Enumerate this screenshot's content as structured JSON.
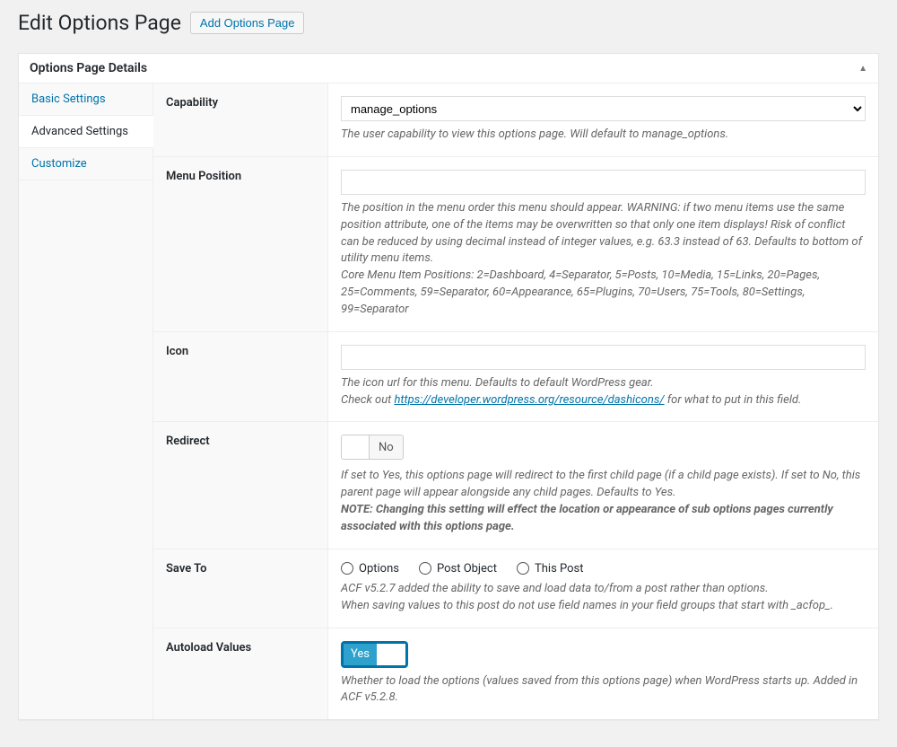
{
  "header": {
    "title": "Edit Options Page",
    "add_button": "Add Options Page"
  },
  "panel": {
    "title": "Options Page Details"
  },
  "sidebar": {
    "basic": "Basic Settings",
    "advanced": "Advanced Settings",
    "customize": "Customize"
  },
  "fields": {
    "capability": {
      "label": "Capability",
      "value": "manage_options",
      "desc": "The user capability to view this options page. Will default to manage_options."
    },
    "menu_position": {
      "label": "Menu Position",
      "value": "",
      "desc1": "The position in the menu order this menu should appear. WARNING: if two menu items use the same position attribute, one of the items may be overwritten so that only one item displays! Risk of conflict can be reduced by using decimal instead of integer values, e.g. 63.3 instead of 63. Defaults to bottom of utility menu items.",
      "desc2": "Core Menu Item Positions: 2=Dashboard, 4=Separator, 5=Posts, 10=Media, 15=Links, 20=Pages, 25=Comments, 59=Separator, 60=Appearance, 65=Plugins, 70=Users, 75=Tools, 80=Settings, 99=Separator"
    },
    "icon": {
      "label": "Icon",
      "value": "",
      "desc1": "The icon url for this menu. Defaults to default WordPress gear.",
      "desc2a": "Check out ",
      "desc2_link": "https://developer.wordpress.org/resource/dashicons/",
      "desc2b": " for what to put in this field."
    },
    "redirect": {
      "label": "Redirect",
      "toggle_label": "No",
      "desc1": "If set to Yes, this options page will redirect to the first child page (if a child page exists). If set to No, this parent page will appear alongside any child pages. Defaults to Yes.",
      "desc2": "NOTE: Changing this setting will effect the location or appearance of sub options pages currently associated with this options page."
    },
    "save_to": {
      "label": "Save To",
      "opt1": "Options",
      "opt2": "Post Object",
      "opt3": "This Post",
      "desc1": "ACF v5.2.7 added the ability to save and load data to/from a post rather than options.",
      "desc2": "When saving values to this post do not use field names in your field groups that start with _acfop_."
    },
    "autoload": {
      "label": "Autoload Values",
      "toggle_label": "Yes",
      "desc": "Whether to load the options (values saved from this options page) when WordPress starts up. Added in ACF v5.2.8."
    }
  }
}
